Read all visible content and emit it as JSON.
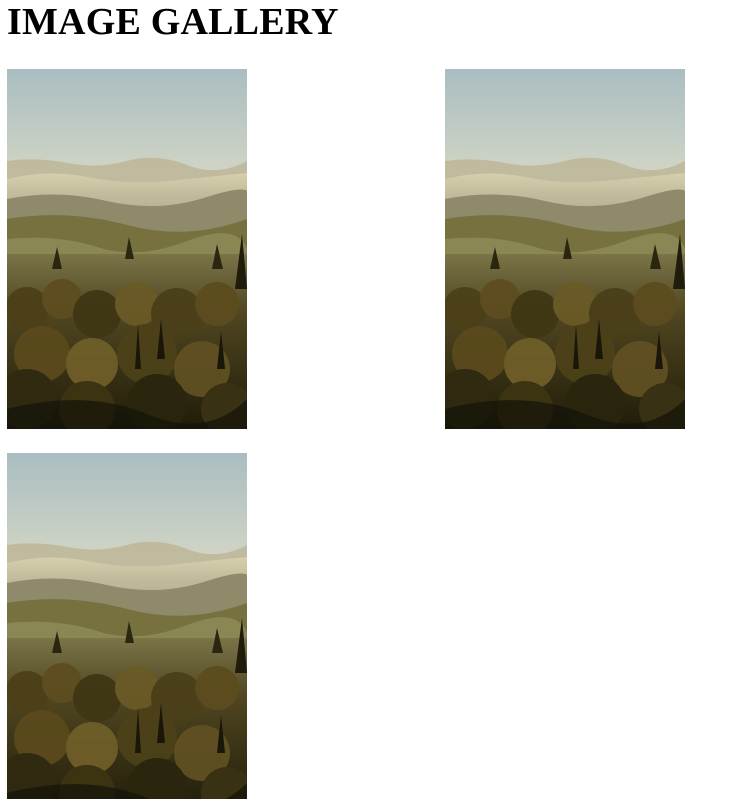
{
  "page": {
    "title": "IMAGE GALLERY"
  },
  "gallery": {
    "images": [
      {
        "subject": "misty-valley-landscape"
      },
      {
        "subject": "misty-valley-landscape"
      },
      {
        "subject": "misty-valley-landscape"
      }
    ]
  },
  "palette": {
    "sky_top": "#a8bcc0",
    "sky_glow": "#f4e8bf",
    "haze": "#cfc7a6",
    "hills_far": "#8f8a70",
    "hills_mid": "#6f6a4a",
    "field": "#8c8a55",
    "foliage_dark": "#2e2a12",
    "foliage_mid": "#5a4a20",
    "foliage_light": "#8a7a3a"
  }
}
